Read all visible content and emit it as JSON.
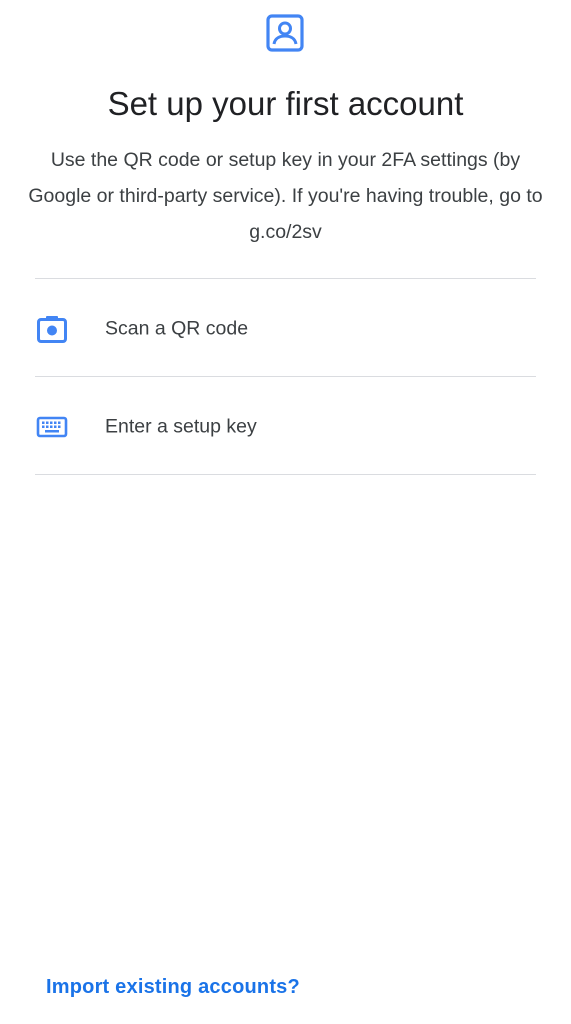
{
  "header": {
    "icon": "account-box-icon",
    "title": "Set up your first account",
    "description": "Use the QR code or setup key in your 2FA settings (by Google or third-party service). If you're having trouble, go to g.co/2sv"
  },
  "options": [
    {
      "icon": "camera-icon",
      "label": "Scan a QR code"
    },
    {
      "icon": "keyboard-icon",
      "label": "Enter a setup key"
    }
  ],
  "footer": {
    "import_label": "Import existing accounts?"
  },
  "colors": {
    "accent": "#1a73e8",
    "icon": "#4285f4",
    "text": "#202124",
    "divider": "#dadce0"
  }
}
